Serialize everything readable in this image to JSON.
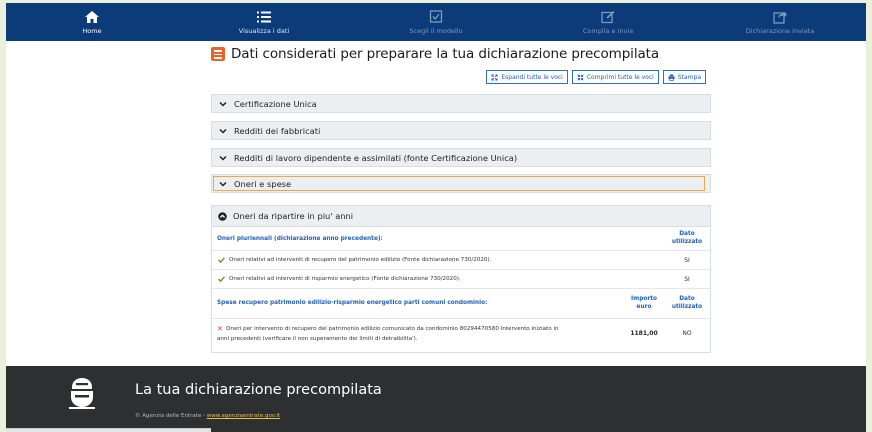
{
  "nav": [
    {
      "label": "Home",
      "icon": "home-icon",
      "state": "normal"
    },
    {
      "label": "Visualizza i dati",
      "icon": "list-icon",
      "state": "active"
    },
    {
      "label": "Scegli il modello",
      "icon": "checkbox-icon",
      "state": "dim"
    },
    {
      "label": "Compila e invia",
      "icon": "edit-icon",
      "state": "dim"
    },
    {
      "label": "Dichiarazione inviata",
      "icon": "share-icon",
      "state": "dim"
    }
  ],
  "heading": {
    "title": "Dati considerati per preparare la tua dichiarazione precompilata"
  },
  "toolbar": {
    "expand_label": "Espandi tutte le voci",
    "collapse_label": "Comprimi tutte le voci",
    "print_label": "Stampa"
  },
  "sections": [
    {
      "label": "Certificazione Unica"
    },
    {
      "label": "Redditi dei fabbricati"
    },
    {
      "label": "Redditi di lavoro dipendente e assimilati (fonte Certificazione Unica)"
    },
    {
      "label": "Oneri e spese"
    }
  ],
  "pluriennali": {
    "title": "Oneri da ripartire in piu' anni",
    "group1": {
      "header": "Oneri pluriennali (dichiarazione anno precedente):",
      "col_dato_line1": "Dato",
      "col_dato_line2": "utilizzato",
      "rows": [
        {
          "text": "Oneri relativi ad interventi di recupero del patrimonio edilizio (Fonte dichiarazione 730/2020).",
          "value": "SI"
        },
        {
          "text": "Oneri relativi ad interventi di risparmio energetico (Fonte dichiarazione 730/2020).",
          "value": "SI"
        }
      ]
    },
    "group2": {
      "header": "Spese recupero patrimonio edilizio-risparmio energetico parti comuni condominio:",
      "col_importo_line1": "Importo",
      "col_importo_line2": "euro",
      "col_dato_line1": "Dato",
      "col_dato_line2": "utilizzato",
      "row": {
        "text_line1": "Oneri per intervento di recupero del patrimonio edilizio comunicato da condominio 80294470580 Intervento iniziato in",
        "text_line2": "anni precedenti (verificare il non superamento dei limiti di detraibilita').",
        "amount": "1181,00",
        "value": "NO"
      }
    }
  },
  "footer": {
    "title": "La tua dichiarazione precompilata",
    "copyright": "© Agenzia delle Entrate -",
    "link": "www.agenziaentrate.gov.it"
  },
  "colors": {
    "nav_bg": "#0b3b78",
    "accent_orange": "#e8632b",
    "link_blue": "#1f5fb5",
    "footer_bg": "#2e2f30",
    "check_green": "#5a9a2a",
    "cross_red": "#d23a2a"
  }
}
